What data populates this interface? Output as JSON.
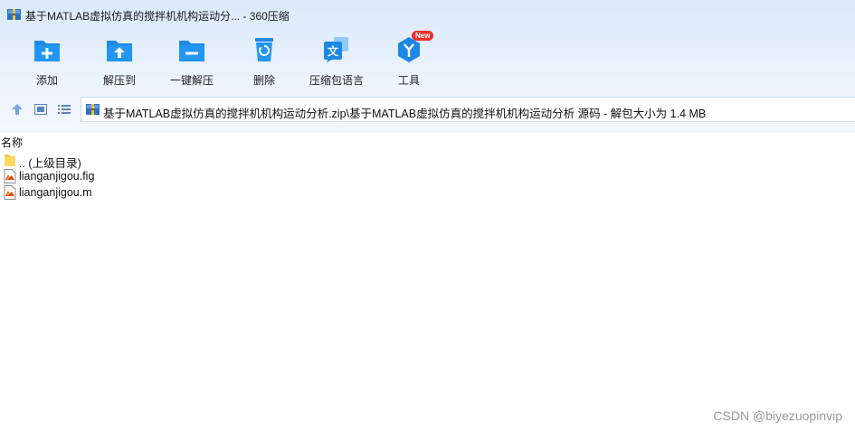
{
  "window": {
    "title": "基于MATLAB虚拟仿真的搅拌机机构运动分... - 360压缩"
  },
  "toolbar": {
    "items": [
      {
        "label": "添加",
        "icon": "folder-add-icon"
      },
      {
        "label": "解压到",
        "icon": "folder-extract-icon"
      },
      {
        "label": "一键解压",
        "icon": "folder-minus-icon"
      },
      {
        "label": "删除",
        "icon": "recycle-bin-icon"
      },
      {
        "label": "压缩包语言",
        "icon": "language-icon"
      },
      {
        "label": "工具",
        "icon": "tools-hexagon-icon",
        "badge": "New"
      }
    ]
  },
  "nav": {
    "path": "基于MATLAB虚拟仿真的搅拌机机构运动分析.zip\\基于MATLAB虚拟仿真的搅拌机机构运动分析 源码 - 解包大小为 1.4 MB"
  },
  "list": {
    "column_name": "名称",
    "rows": [
      {
        "name": ".. (上级目录)",
        "icon": "folder-icon"
      },
      {
        "name": "lianganjigou.fig",
        "icon": "matlab-fig-file-icon"
      },
      {
        "name": "lianganjigou.m",
        "icon": "matlab-m-file-icon"
      }
    ]
  },
  "watermark": "CSDN @biyezuopinvip",
  "colors": {
    "accent_blue": "#1e88e5",
    "badge_red": "#e8302e",
    "chrome_bg": "#e3eefb"
  }
}
